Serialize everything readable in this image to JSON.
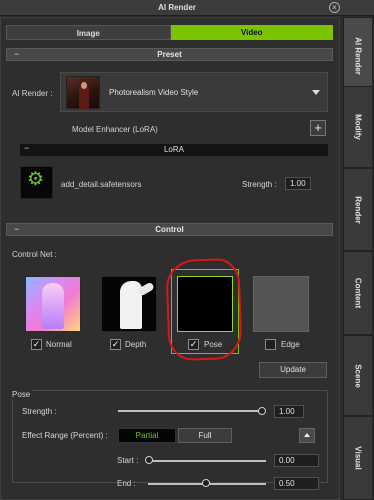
{
  "window": {
    "title": "AI Render",
    "close_icon": "close-circle-icon"
  },
  "tabs": {
    "image": "Image",
    "video": "Video",
    "active": "Video"
  },
  "preset": {
    "header": "Preset",
    "ai_render_label": "AI Render :",
    "style_name": "Photorealism Video Style",
    "model_enhancer_label": "Model Enhancer (LoRA)"
  },
  "lora": {
    "header": "LoRA",
    "file_name": "add_detail.safetensors",
    "strength_label": "Strength :",
    "strength_value": "1.00"
  },
  "control": {
    "header": "Control",
    "control_net_label": "Control Net :",
    "items": [
      {
        "label": "Normal",
        "checked": true
      },
      {
        "label": "Depth",
        "checked": true
      },
      {
        "label": "Pose",
        "checked": true,
        "selected": true
      },
      {
        "label": "Edge",
        "checked": false
      }
    ],
    "update_label": "Update"
  },
  "pose": {
    "group_label": "Pose",
    "strength_label": "Strength :",
    "strength_value": "1.00",
    "effect_range_label": "Effect Range (Percent) :",
    "partial_label": "Partial",
    "full_label": "Full",
    "start_label": "Start :",
    "start_value": "0.00",
    "end_label": "End :",
    "end_value": "0.50"
  },
  "side_tabs": [
    "AI Render",
    "Modify",
    "Render",
    "Content",
    "Scene",
    "Visual"
  ],
  "colors": {
    "accent": "#7cc400",
    "annotation": "#d81818"
  }
}
